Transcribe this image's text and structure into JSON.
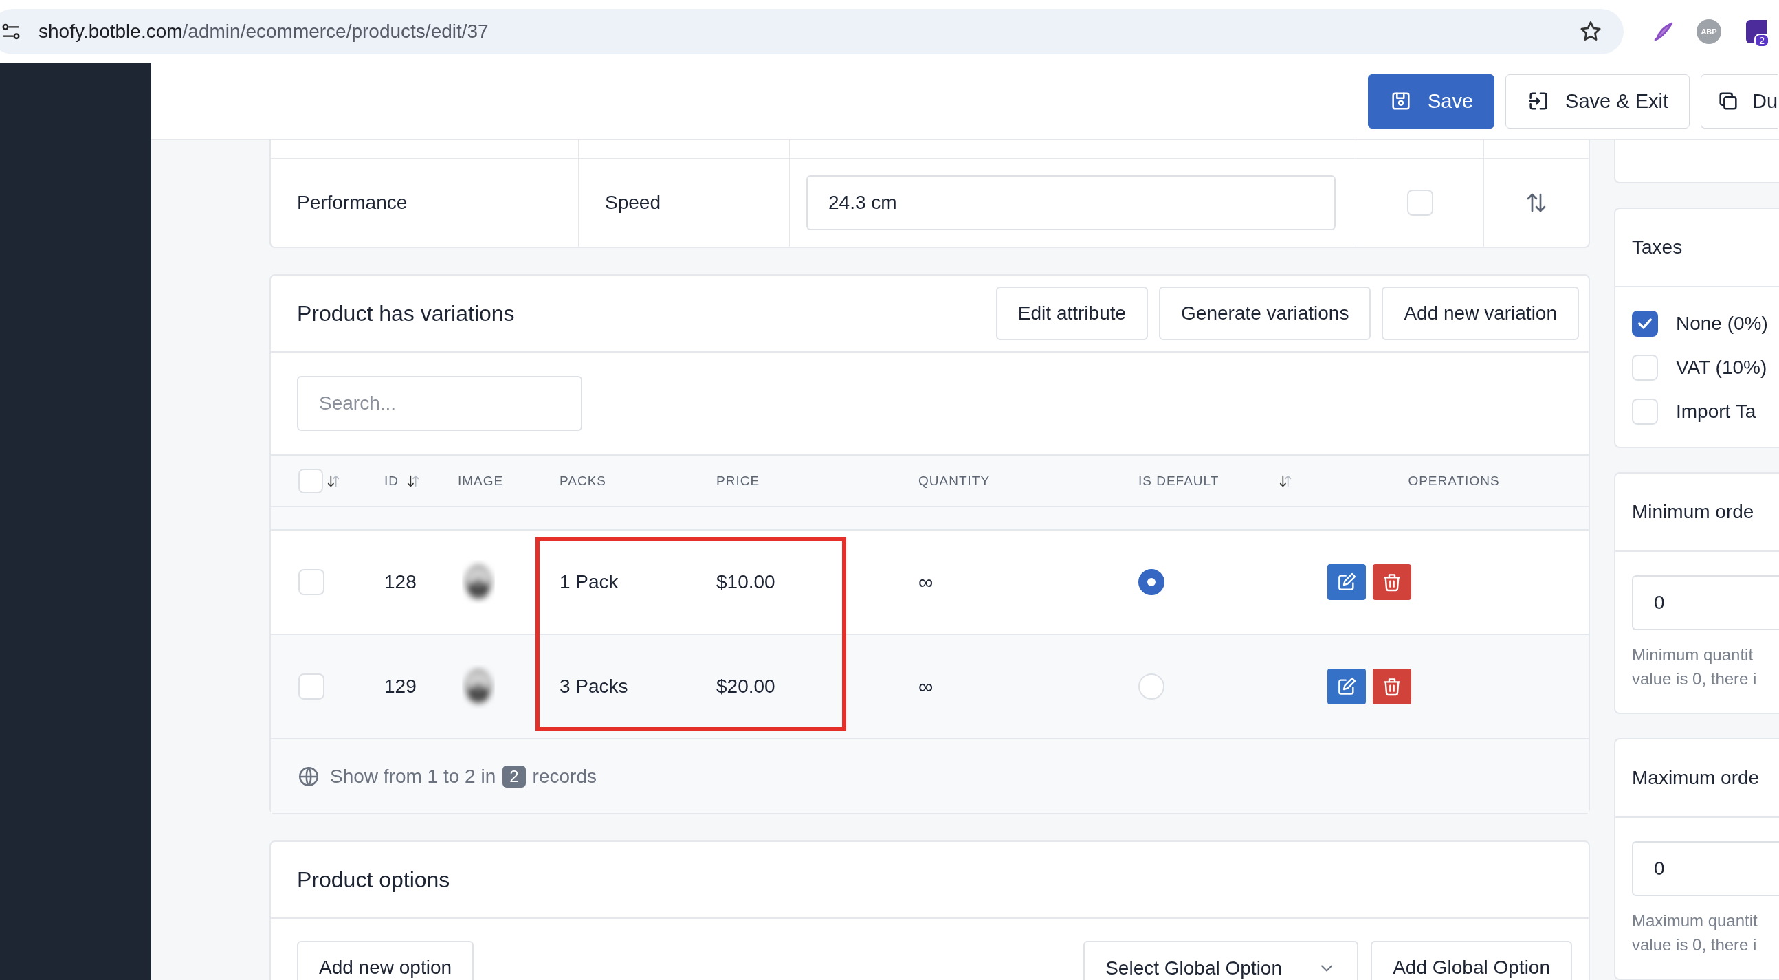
{
  "browser": {
    "url_host": "shofy.botble.com",
    "url_path": "/admin/ecommerce/products/edit/37",
    "extensions": [
      {
        "kind": "pen"
      },
      {
        "kind": "abp",
        "label": "ABP"
      },
      {
        "kind": "badge",
        "label": "2"
      }
    ]
  },
  "header_buttons": [
    {
      "label": "Save",
      "kind": "primary"
    },
    {
      "label": "Save & Exit",
      "kind": "exit"
    },
    {
      "label": "Du",
      "kind": "duplicate"
    }
  ],
  "attribute_row": {
    "group": "Performance",
    "name": "Speed",
    "value": "24.3 cm",
    "checked": false
  },
  "variations": {
    "title": "Product has variations",
    "actions": [
      "Edit attribute",
      "Generate variations",
      "Add new variation"
    ],
    "search": {
      "placeholder": "Search..."
    },
    "columns": [
      {
        "kind": "select",
        "sortable": true,
        "checked": false
      },
      {
        "kind": "text",
        "label": "ID",
        "sortable": true
      },
      {
        "kind": "text",
        "label": "IMAGE",
        "sortable": false
      },
      {
        "kind": "text",
        "label": "PACKS",
        "sortable": false
      },
      {
        "kind": "text",
        "label": "PRICE",
        "sortable": false
      },
      {
        "kind": "text",
        "label": "QUANTITY",
        "sortable": false
      },
      {
        "kind": "text",
        "label": "IS DEFAULT",
        "sortable": false
      },
      {
        "kind": "sort",
        "sortable": true
      },
      {
        "kind": "center",
        "label": "OPERATIONS",
        "sortable": false
      }
    ],
    "rows": [
      {
        "checked": false,
        "id": "128",
        "pack": "1 Pack",
        "price": "$10.00",
        "quantity": "∞",
        "selected": true
      },
      {
        "checked": false,
        "id": "129",
        "pack": "3 Packs",
        "price": "$20.00",
        "quantity": "∞",
        "selected": false
      }
    ],
    "annotation": {
      "kind": "frame"
    },
    "footer": {
      "before": "Show from 1 to 2 in",
      "count": "2",
      "after": "records"
    }
  },
  "options": {
    "title": "Product options",
    "add_button": "Add new option",
    "global_select": "Select Global Option",
    "add_global_button": "Add Global Option"
  },
  "taxes": {
    "title": "Taxes",
    "items": [
      {
        "label": "None (0%)",
        "checked": true
      },
      {
        "label": "VAT (10%)",
        "checked": false
      },
      {
        "label": "Import Ta",
        "checked": false
      }
    ]
  },
  "limits": [
    {
      "title": "Minimum orde",
      "value": "0",
      "help": [
        "Minimum quantit",
        "value is 0, there i"
      ]
    },
    {
      "title": "Maximum orde",
      "value": "0",
      "help": [
        "Maximum quantit",
        "value is 0, there i"
      ]
    }
  ]
}
